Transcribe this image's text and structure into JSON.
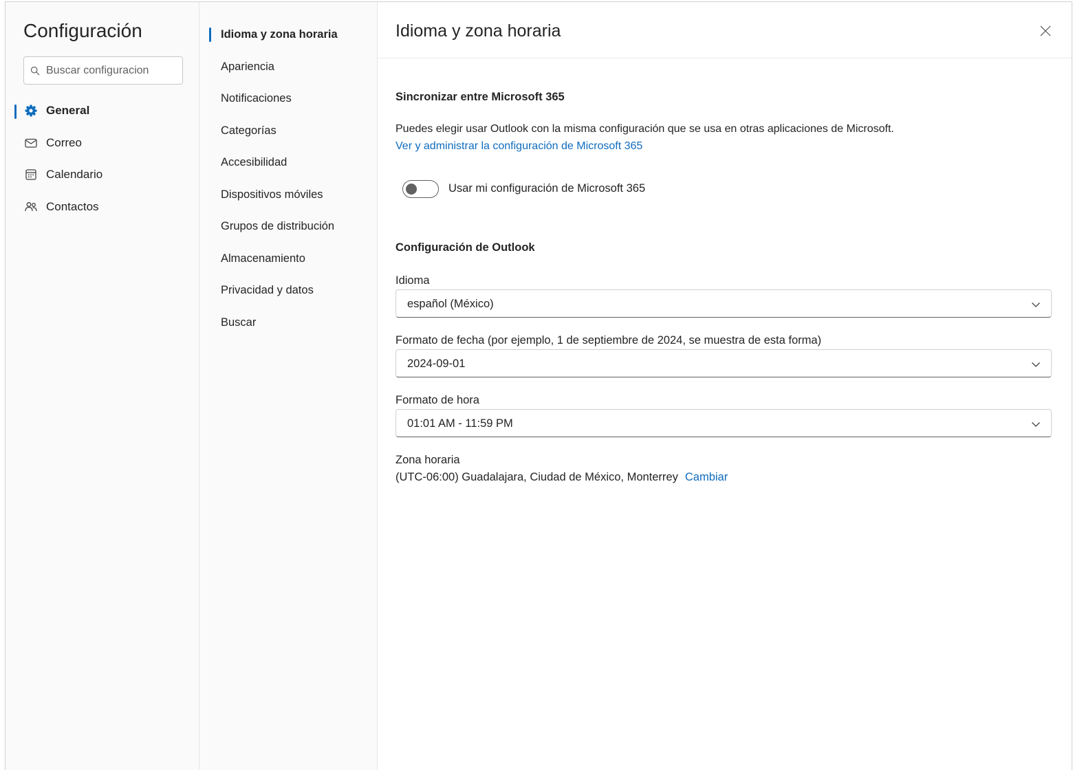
{
  "sidebar": {
    "title": "Configuración",
    "search_placeholder": "Buscar configuracion",
    "items": [
      {
        "label": "General",
        "icon": "gear-icon",
        "active": true
      },
      {
        "label": "Correo",
        "icon": "mail-icon",
        "active": false
      },
      {
        "label": "Calendario",
        "icon": "calendar-icon",
        "active": false
      },
      {
        "label": "Contactos",
        "icon": "people-icon",
        "active": false
      }
    ]
  },
  "subnav": {
    "items": [
      {
        "label": "Idioma y zona horaria",
        "active": true
      },
      {
        "label": "Apariencia"
      },
      {
        "label": "Notificaciones"
      },
      {
        "label": "Categorías"
      },
      {
        "label": "Accesibilidad"
      },
      {
        "label": "Dispositivos móviles"
      },
      {
        "label": "Grupos de distribución"
      },
      {
        "label": "Almacenamiento"
      },
      {
        "label": "Privacidad y datos"
      },
      {
        "label": "Buscar"
      }
    ]
  },
  "main": {
    "title": "Idioma y zona horaria",
    "sync": {
      "heading": "Sincronizar entre Microsoft 365",
      "description": "Puedes elegir usar Outlook con la misma configuración que se usa en otras aplicaciones de Microsoft.",
      "link": "Ver y administrar la configuración de Microsoft 365",
      "toggle_label": "Usar mi configuración de Microsoft 365",
      "toggle_on": false
    },
    "outlook": {
      "heading": "Configuración de Outlook",
      "language_label": "Idioma",
      "language_value": "español (México)",
      "date_label": "Formato de fecha (por ejemplo, 1 de septiembre de 2024, se muestra de esta forma)",
      "date_value": "2024-09-01",
      "time_label": "Formato de hora",
      "time_value": "01:01 AM - 11:59 PM",
      "timezone_label": "Zona horaria",
      "timezone_value": "(UTC-06:00) Guadalajara, Ciudad de México, Monterrey",
      "timezone_change": "Cambiar"
    }
  },
  "colors": {
    "accent": "#0f6cbd",
    "text": "#242424",
    "pane_bg": "#fafafa"
  }
}
